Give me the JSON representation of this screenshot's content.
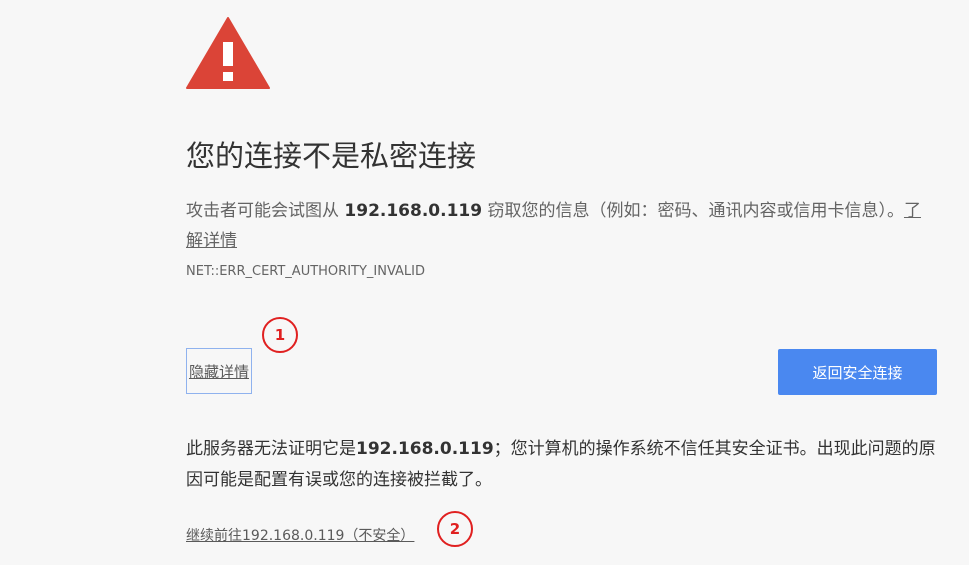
{
  "icon": {
    "name": "warning-triangle-icon",
    "color": "#db4437"
  },
  "heading": "您的连接不是私密连接",
  "explanation": {
    "prefix": "攻击者可能会试图从 ",
    "host": "192.168.0.119",
    "suffix": " 窃取您的信息（例如：密码、通讯内容或信用卡信息）。",
    "learn_more": "了解详情"
  },
  "error_code": "NET::ERR_CERT_AUTHORITY_INVALID",
  "buttons": {
    "details": "隐藏详情",
    "back_to_safety": "返回安全连接"
  },
  "annotations": [
    "1",
    "2"
  ],
  "details": {
    "prefix": "此服务器无法证明它是",
    "host": "192.168.0.119",
    "suffix": "；您计算机的操作系统不信任其安全证书。出现此问题的原因可能是配置有误或您的连接被拦截了。"
  },
  "proceed_link": "继续前往192.168.0.119（不安全）",
  "colors": {
    "background": "#f7f7f7",
    "primary_button": "#4a88f0",
    "annotation": "#e02020"
  }
}
